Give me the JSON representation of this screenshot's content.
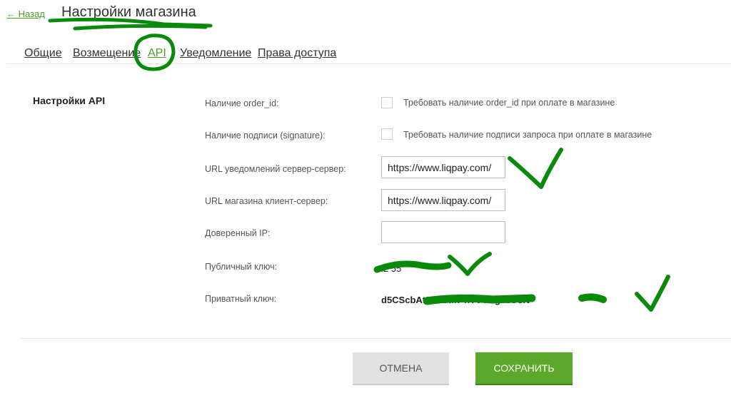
{
  "header": {
    "back_label": "← Назад",
    "title": "Настройки магазина"
  },
  "tabs": [
    {
      "label": "Общие",
      "active": false
    },
    {
      "label": "Возмещение",
      "active": false
    },
    {
      "label": "API",
      "active": true
    },
    {
      "label": "Уведомление",
      "active": false
    },
    {
      "label": "Права доступа",
      "active": false
    }
  ],
  "section": {
    "title": "Настройки API"
  },
  "fields": {
    "order_id": {
      "label": "Наличие order_id:",
      "checkbox_label": "Требовать наличие order_id при оплате в магазине",
      "checked": false
    },
    "signature": {
      "label": "Наличие подписи (signature):",
      "checkbox_label": "Требовать наличие подписи запроса при оплате в магазине",
      "checked": false
    },
    "server_url": {
      "label": "URL уведомлений сервер-сервер:",
      "value": "https://www.liqpay.com/"
    },
    "result_url": {
      "label": "URL магазина клиент-сервер:",
      "value": "https://www.liqpay.com/"
    },
    "trusted_ip": {
      "label": "Доверенный IP:",
      "value": ""
    },
    "public_key": {
      "label": "Публичный ключ:",
      "value": "i2          55"
    },
    "private_key": {
      "label": "Приватный ключ:",
      "value": "d5CScbAt8In       OM7  nTVYNgI   eUoN"
    }
  },
  "buttons": {
    "cancel_label": "ОТМЕНА",
    "save_label": "СОХРАНИТЬ"
  },
  "colors": {
    "accent": "#5ca82a",
    "annotation": "#0a8a0a",
    "link": "#4a9d2a"
  }
}
